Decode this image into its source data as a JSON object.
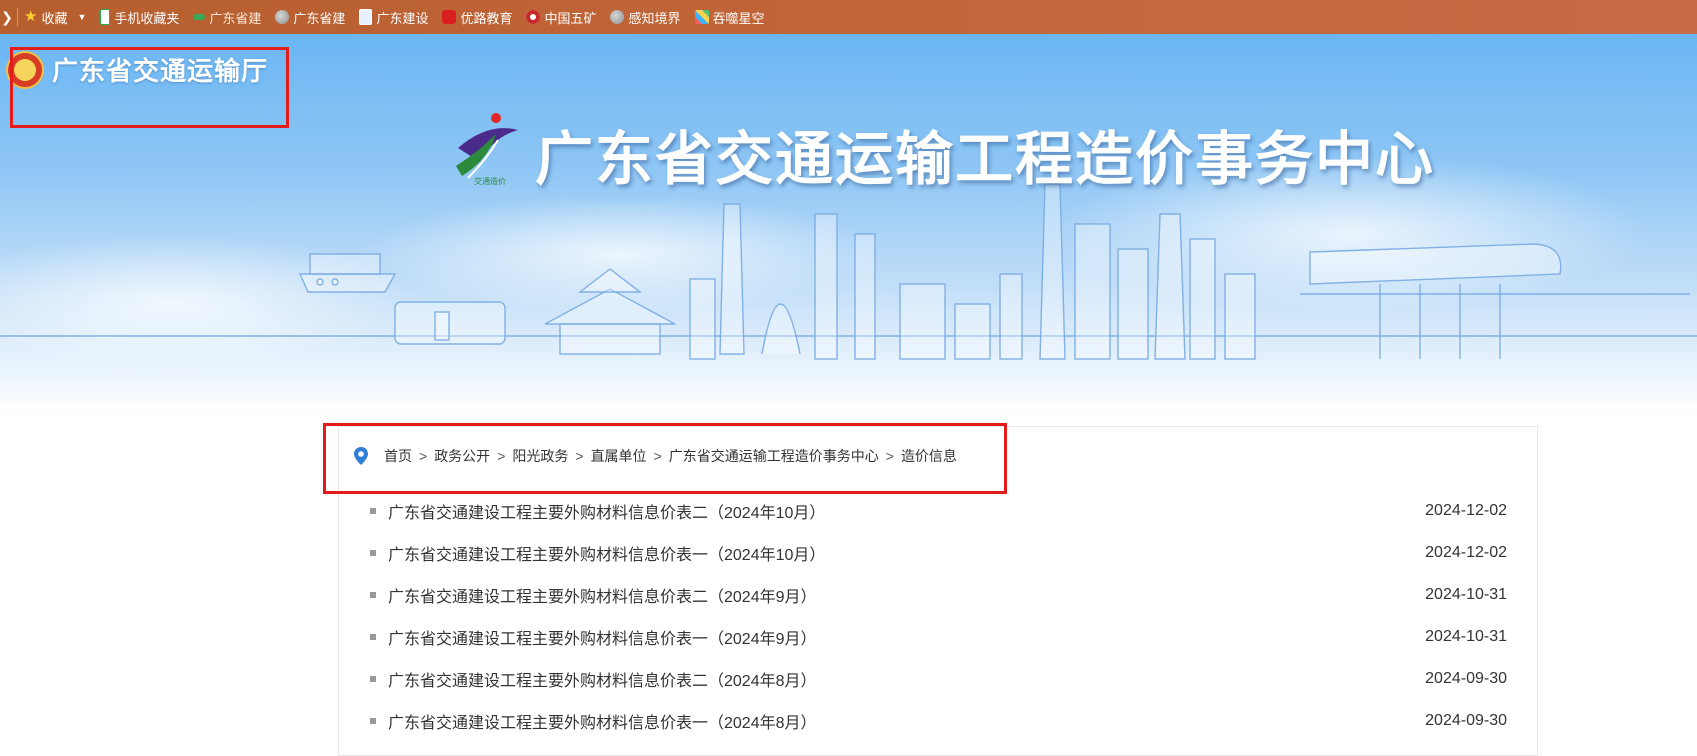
{
  "bookmarks": {
    "items": [
      {
        "label": "收藏",
        "icon": "star-icon"
      },
      {
        "label": "手机收藏夹",
        "icon": "phone-icon"
      },
      {
        "label": "广东省建",
        "icon": "site-icon"
      },
      {
        "label": "广东省建",
        "icon": "globe-icon"
      },
      {
        "label": "广东建设",
        "icon": "document-icon"
      },
      {
        "label": "优路教育",
        "icon": "youlu-icon"
      },
      {
        "label": "中国五矿",
        "icon": "minmetals-icon"
      },
      {
        "label": "感知境界",
        "icon": "globe-icon"
      },
      {
        "label": "吞噬星空",
        "icon": "grid-icon"
      }
    ]
  },
  "header": {
    "org_name": "广东省交通运输厅",
    "center_title": "广东省交通运输工程造价事务中心",
    "logo_caption": "交通造价"
  },
  "breadcrumb": {
    "items": [
      "首页",
      "政务公开",
      "阳光政务",
      "直属单位",
      "广东省交通运输工程造价事务中心",
      "造价信息"
    ],
    "separator": ">"
  },
  "list": {
    "items": [
      {
        "title": "广东省交通建设工程主要外购材料信息价表二（2024年10月）",
        "date": "2024-12-02"
      },
      {
        "title": "广东省交通建设工程主要外购材料信息价表一（2024年10月）",
        "date": "2024-12-02"
      },
      {
        "title": "广东省交通建设工程主要外购材料信息价表二（2024年9月）",
        "date": "2024-10-31"
      },
      {
        "title": "广东省交通建设工程主要外购材料信息价表一（2024年9月）",
        "date": "2024-10-31"
      },
      {
        "title": "广东省交通建设工程主要外购材料信息价表二（2024年8月）",
        "date": "2024-09-30"
      },
      {
        "title": "广东省交通建设工程主要外购材料信息价表一（2024年8月）",
        "date": "2024-09-30"
      }
    ]
  },
  "colors": {
    "highlight_box": "#e41b1b",
    "bookmark_bar": "#c2663a",
    "banner_sky": "#8ec6f5",
    "pin": "#2f7fd8"
  }
}
